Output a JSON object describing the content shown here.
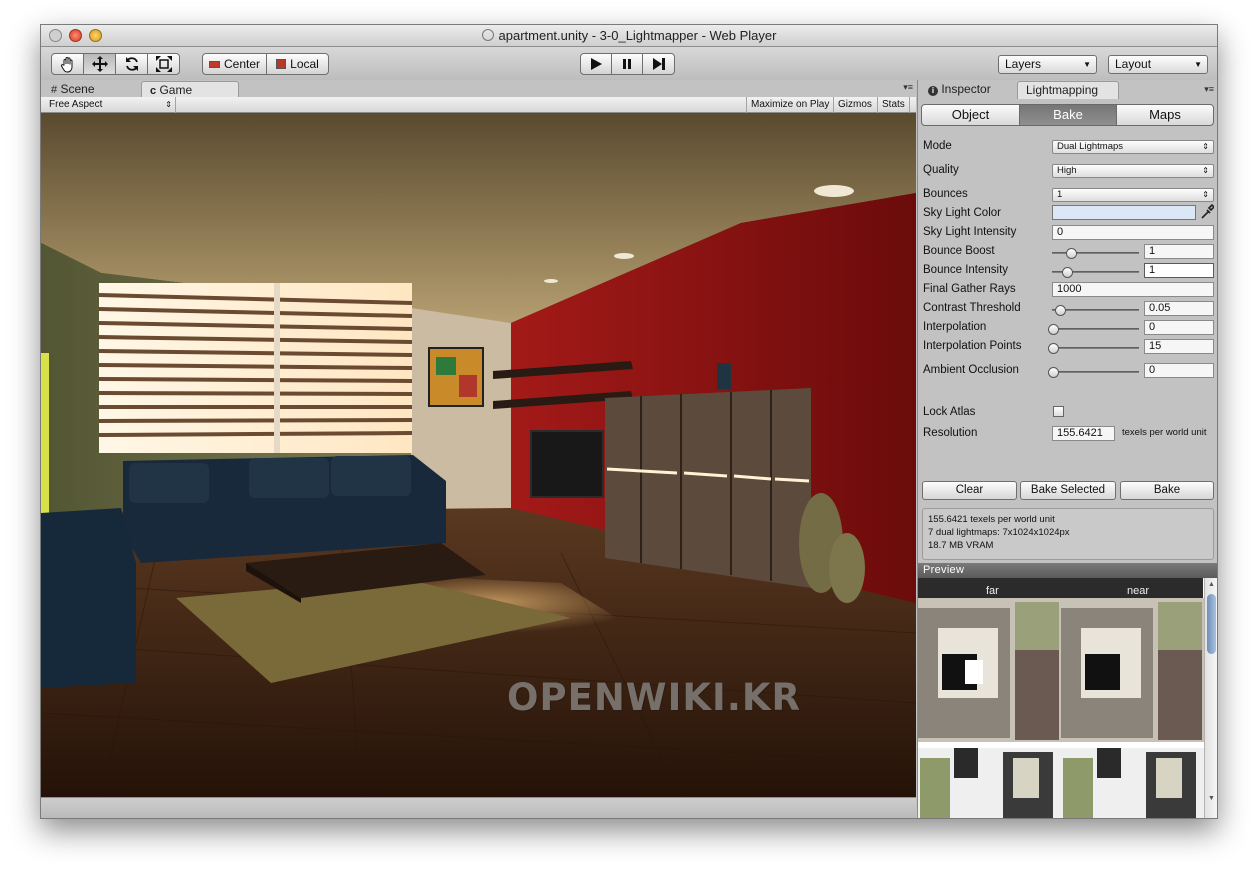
{
  "window": {
    "title": "apartment.unity - 3-0_Lightmapper - Web Player"
  },
  "toolbar": {
    "center_label": "Center",
    "local_label": "Local",
    "layers_label": "Layers",
    "layout_label": "Layout"
  },
  "left_tabs": {
    "scene": "Scene",
    "game": "Game"
  },
  "game_bar": {
    "aspect": "Free Aspect",
    "maximize": "Maximize on Play",
    "gizmos": "Gizmos",
    "stats": "Stats"
  },
  "right_tabs": {
    "inspector": "Inspector",
    "lightmapping": "Lightmapping"
  },
  "segments": {
    "object": "Object",
    "bake": "Bake",
    "maps": "Maps"
  },
  "bake": {
    "mode_label": "Mode",
    "mode_value": "Dual Lightmaps",
    "quality_label": "Quality",
    "quality_value": "High",
    "bounces_label": "Bounces",
    "bounces_value": "1",
    "sky_color_label": "Sky Light Color",
    "sky_intensity_label": "Sky Light Intensity",
    "sky_intensity_value": "0",
    "bounce_boost_label": "Bounce Boost",
    "bounce_boost_value": "1",
    "bounce_intensity_label": "Bounce Intensity",
    "bounce_intensity_value": "1",
    "final_gather_label": "Final Gather Rays",
    "final_gather_value": "1000",
    "contrast_label": "Contrast Threshold",
    "contrast_value": "0.05",
    "interpolation_label": "Interpolation",
    "interpolation_value": "0",
    "interp_points_label": "Interpolation Points",
    "interp_points_value": "15",
    "ao_label": "Ambient Occlusion",
    "ao_value": "0",
    "lock_atlas_label": "Lock Atlas",
    "resolution_label": "Resolution",
    "resolution_value": "155.6421",
    "resolution_unit": "texels per world unit",
    "clear_label": "Clear",
    "bake_selected_label": "Bake Selected",
    "bake_label": "Bake"
  },
  "info": {
    "line1": "155.6421 texels per world unit",
    "line2": "7 dual lightmaps: 7x1024x1024px",
    "line3": "18.7 MB VRAM"
  },
  "preview": {
    "header": "Preview",
    "far_label": "far",
    "near_label": "near"
  },
  "watermark": "OPENWIKI.KR",
  "colors": {
    "sky_light": "#dbe6f7",
    "selected_segment": "#808080",
    "accent_red_wall": "#8e1414"
  },
  "icons": {
    "hand": "hand-tool-icon",
    "move": "move-tool-icon",
    "rotate": "rotate-tool-icon",
    "scale": "scale-tool-icon",
    "play": "play-icon",
    "pause": "pause-icon",
    "step": "step-icon",
    "eyedropper": "eyedropper-icon"
  }
}
